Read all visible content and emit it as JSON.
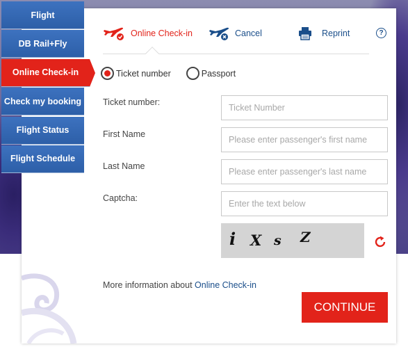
{
  "sidenav": {
    "items": [
      {
        "label": "Flight"
      },
      {
        "label": "DB Rail+Fly"
      },
      {
        "label": "Online Check-in"
      },
      {
        "label": "Check my booking"
      },
      {
        "label": "Flight Status"
      },
      {
        "label": "Flight Schedule"
      }
    ]
  },
  "actions": {
    "checkin": "Online Check-in",
    "cancel": "Cancel",
    "reprint": "Reprint",
    "help": "?"
  },
  "search_by": {
    "option1": "Ticket number",
    "option2": "Passport",
    "selected": "Ticket number"
  },
  "form": {
    "ticket_label": "Ticket number:",
    "ticket_placeholder": "Ticket Number",
    "firstname_label": "First Name",
    "firstname_placeholder": "Please enter passenger's first name",
    "lastname_label": "Last Name",
    "lastname_placeholder": "Please enter passenger's last name",
    "captcha_label": "Captcha:",
    "captcha_placeholder": "Enter the text below"
  },
  "captcha_chars": [
    "i",
    "X",
    "s",
    "Z"
  ],
  "more_info": {
    "prefix": "More information about ",
    "link": "Online Check-in"
  },
  "continue_label": "CONTINUE",
  "colors": {
    "accent_red": "#e2231a",
    "nav_blue": "#2d5fa8",
    "link_blue": "#1a4e8a"
  }
}
